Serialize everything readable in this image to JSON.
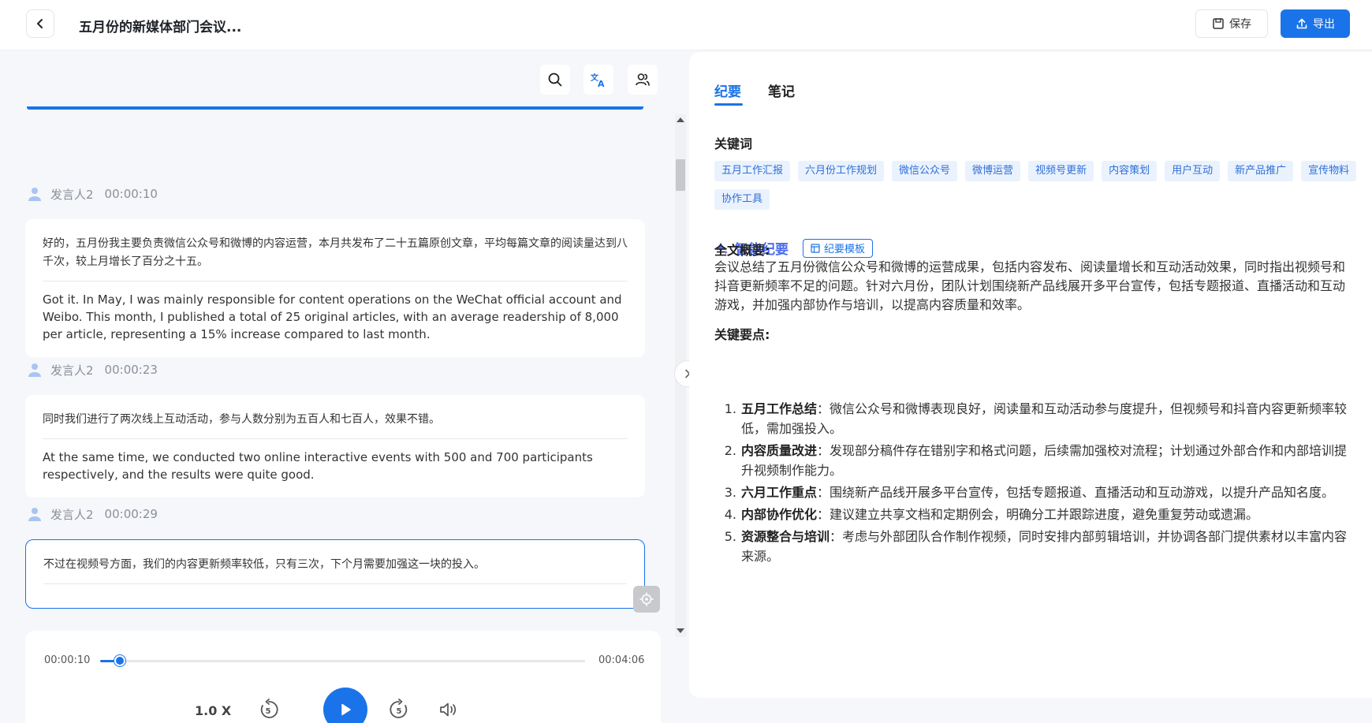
{
  "header": {
    "title": "五月份的新媒体部门会议...",
    "save_label": "保存",
    "export_label": "导出"
  },
  "segments": [
    {
      "speaker": "发言人2",
      "time": "00:00:10",
      "zh": "好的，五月份我主要负责微信公众号和微博的内容运营，本月共发布了二十五篇原创文章，平均每篇文章的阅读量达到八千次，较上月增长了百分之十五。",
      "en": "Got it. In May, I was mainly responsible for content operations on the WeChat official account and Weibo. This month, I published a total of 25 original articles, with an average readership of 8,000 per article, representing a 15% increase compared to last month."
    },
    {
      "speaker": "发言人2",
      "time": "00:00:23",
      "zh": "同时我们进行了两次线上互动活动，参与人数分别为五百人和七百人，效果不错。",
      "en": "At the same time, we conducted two online interactive events with 500 and 700 participants respectively, and the results were quite good."
    },
    {
      "speaker": "发言人2",
      "time": "00:00:29",
      "zh": "不过在视频号方面，我们的内容更新频率较低，只有三次，下个月需要加强这一块的投入。",
      "en": ""
    }
  ],
  "player": {
    "current_time": "00:00:10",
    "total_time": "00:04:06",
    "progress_fraction": 0.041,
    "speed": "1.0 X"
  },
  "right": {
    "tabs": [
      "纪要",
      "笔记"
    ],
    "keywords_title": "关键词",
    "keywords": [
      "五月工作汇报",
      "六月份工作规划",
      "微信公众号",
      "微博运营",
      "视频号更新",
      "内容策划",
      "用户互动",
      "新产品推广",
      "宣传物料",
      "协作工具"
    ],
    "smart_title": "智能纪要",
    "template_label": "纪要模板",
    "summary_label": "全文概要:",
    "summary": "会议总结了五月份微信公众号和微博的运营成果，包括内容发布、阅读量增长和互动活动效果，同时指出视频号和抖音更新频率不足的问题。针对六月份，团队计划围绕新产品线展开多平台宣传，包括专题报道、直播活动和互动游戏，并加强内部协作与培训，以提高内容质量和效率。",
    "points_label": "关键要点:",
    "points": [
      {
        "num": "1.",
        "title": "五月工作总结",
        "text": "：微信公众号和微博表现良好，阅读量和互动活动参与度提升，但视频号和抖音内容更新频率较低，需加强投入。"
      },
      {
        "num": "2.",
        "title": "内容质量改进",
        "text": "：发现部分稿件存在错别字和格式问题，后续需加强校对流程；计划通过外部合作和内部培训提升视频制作能力。"
      },
      {
        "num": "3.",
        "title": "六月工作重点",
        "text": "：围绕新产品线开展多平台宣传，包括专题报道、直播活动和互动游戏，以提升产品知名度。"
      },
      {
        "num": "4.",
        "title": "内部协作优化",
        "text": "：建议建立共享文档和定期例会，明确分工并跟踪进度，避免重复劳动或遗漏。"
      },
      {
        "num": "5.",
        "title": "资源整合与培训",
        "text": "：考虑与外部团队合作制作视频，同时安排内部剪辑培训，并协调各部门提供素材以丰富内容来源。"
      }
    ]
  },
  "colors": {
    "accent": "#1a73e8",
    "keyword_bg": "#eaf2fe",
    "page_bg": "#f5f7fa"
  }
}
